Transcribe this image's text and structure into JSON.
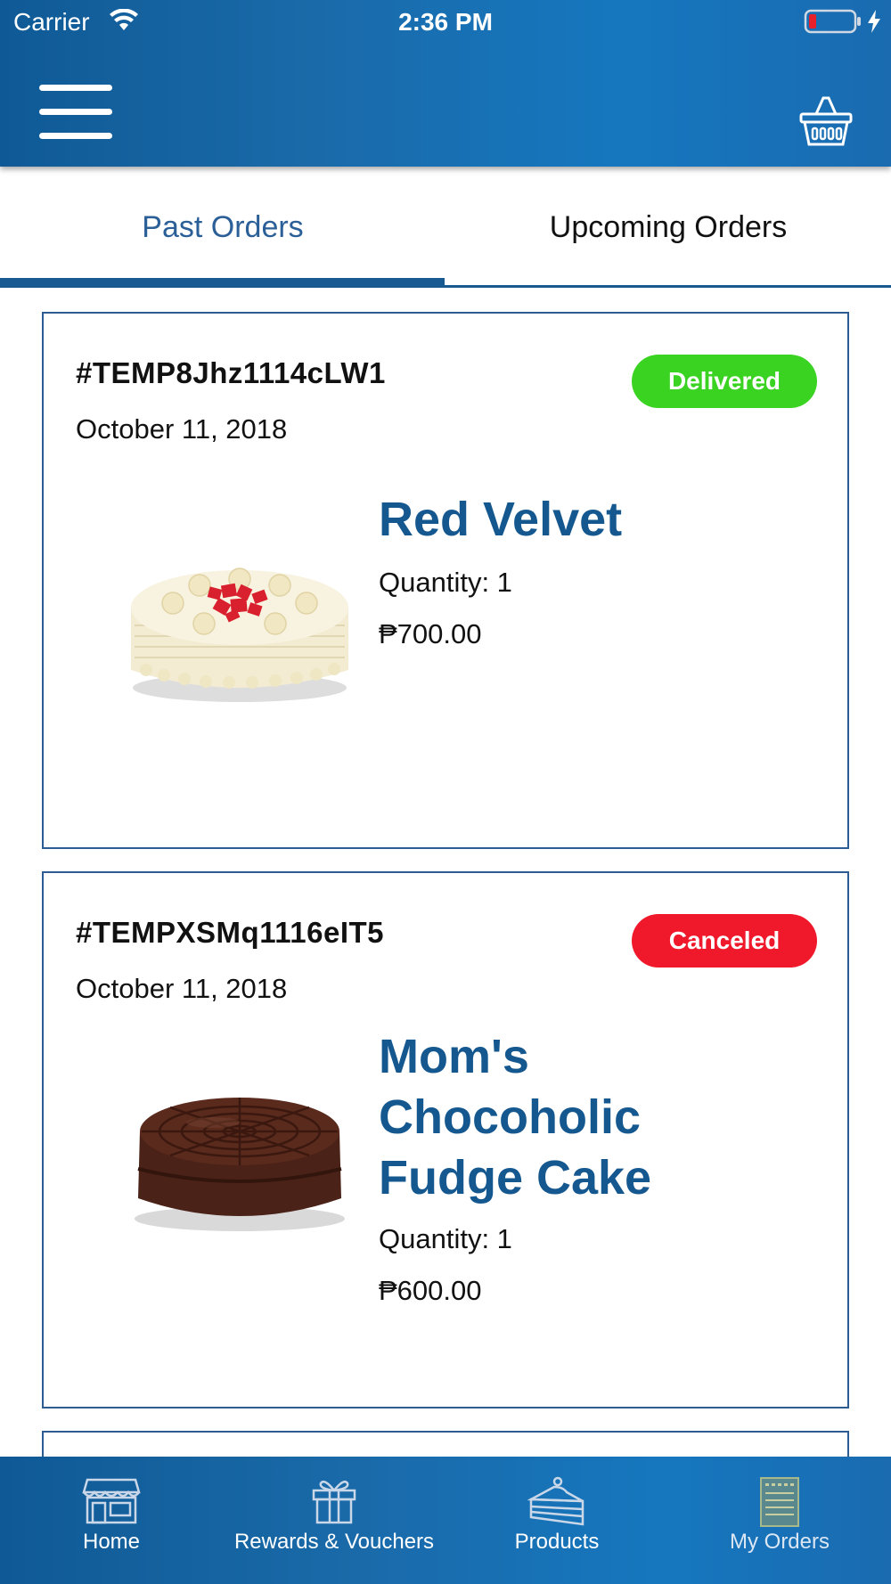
{
  "status_bar": {
    "carrier": "Carrier",
    "time": "2:36 PM"
  },
  "header": {
    "menu_icon": "hamburger-menu-icon",
    "cart_icon": "basket-icon"
  },
  "tabs": [
    {
      "label": "Past Orders",
      "active": true
    },
    {
      "label": "Upcoming Orders",
      "active": false
    }
  ],
  "orders": [
    {
      "order_id": "#TEMP8Jhz1114cLW1",
      "date": "October 11, 2018",
      "status": "Delivered",
      "status_color": "#3ad321",
      "product_name_lines": [
        "Red Velvet"
      ],
      "quantity": "Quantity: 1",
      "price": "₱700.00"
    },
    {
      "order_id": "#TEMPXSMq1116eIT5",
      "date": "October 11, 2018",
      "status": "Canceled",
      "status_color": "#f0182b",
      "product_name_lines": [
        "Mom's",
        "Chocoholic",
        "Fudge Cake"
      ],
      "quantity": "Quantity: 1",
      "price": "₱600.00"
    }
  ],
  "bottom_nav": [
    {
      "label": "Home",
      "icon": "storefront-icon"
    },
    {
      "label": "Rewards & Vouchers",
      "icon": "gift-icon"
    },
    {
      "label": "Products",
      "icon": "cake-slice-icon"
    },
    {
      "label": "My Orders",
      "icon": "orders-list-icon",
      "active": true
    }
  ],
  "colors": {
    "brand_blue": "#1a6aa9",
    "title_blue": "#15588f",
    "delivered_green": "#3ad321",
    "canceled_red": "#f0182b"
  }
}
